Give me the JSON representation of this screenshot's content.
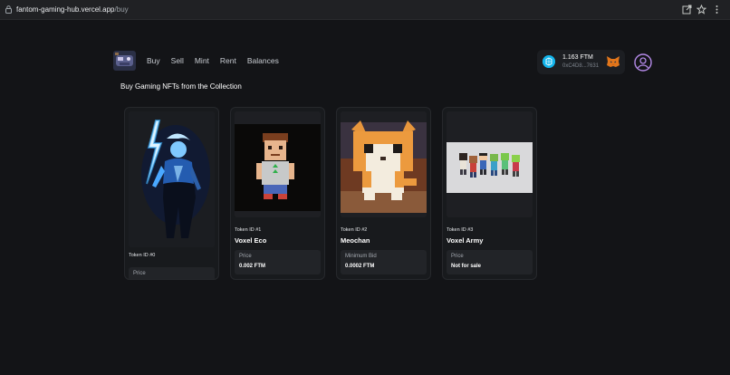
{
  "browser": {
    "url_host": "fantom-gaming-hub.vercel.app",
    "url_path": "/buy"
  },
  "nav": {
    "links": [
      "Buy",
      "Sell",
      "Mint",
      "Rent",
      "Balances"
    ]
  },
  "wallet": {
    "balance": "1.163 FTM",
    "address": "0xC4D8...7631",
    "token_icon": "fantom-icon",
    "provider_icon": "metamask-fox-icon"
  },
  "page": {
    "heading": "Buy Gaming NFTs from the Collection"
  },
  "cards": [
    {
      "token_id": "Token ID #0",
      "name": "",
      "price_label": "Price",
      "price_value": "",
      "image": "zeus-lightning-art"
    },
    {
      "token_id": "Token ID #1",
      "name": "Voxel Eco",
      "price_label": "Price",
      "price_value": "0.002 FTM",
      "image": "voxel-character"
    },
    {
      "token_id": "Token ID #2",
      "name": "Meochan",
      "price_label": "Minimum Bid",
      "price_value": "0.0002 FTM",
      "image": "voxel-cat"
    },
    {
      "token_id": "Token ID #3",
      "name": "Voxel Army",
      "price_label": "Price",
      "price_value": "Not for sale",
      "image": "voxel-army"
    }
  ],
  "colors": {
    "background": "#131417",
    "card": "#181a1d",
    "price_box": "#222428",
    "fantom_blue": "#13b5ec",
    "profile_purple": "#b48ae8"
  }
}
